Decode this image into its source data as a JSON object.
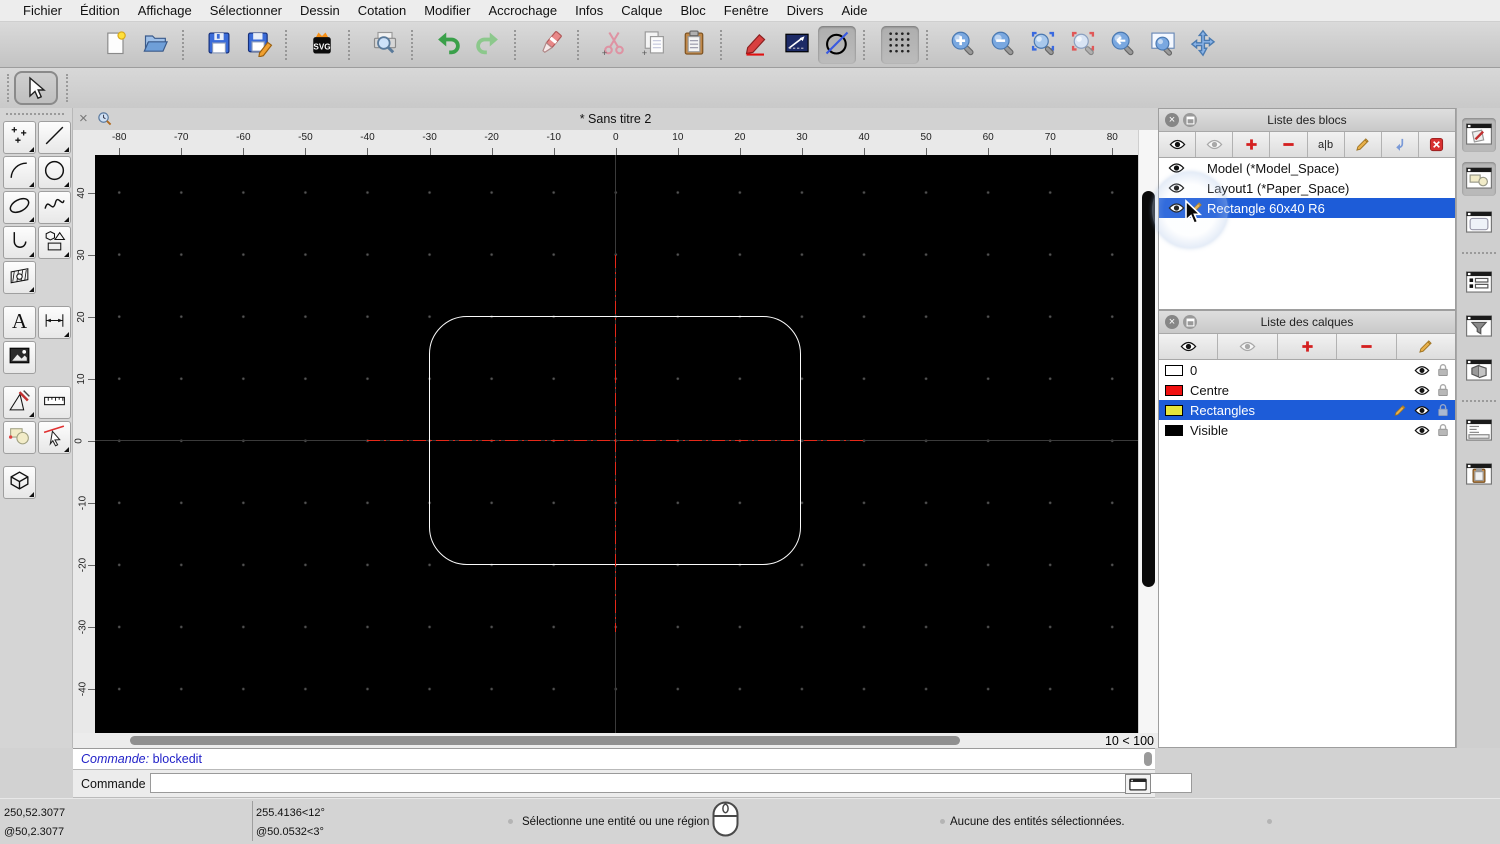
{
  "menu": {
    "items": [
      "Fichier",
      "Édition",
      "Affichage",
      "Sélectionner",
      "Dessin",
      "Cotation",
      "Modifier",
      "Accrochage",
      "Infos",
      "Calque",
      "Bloc",
      "Fenêtre",
      "Divers",
      "Aide"
    ]
  },
  "toolbar": {
    "groups": [
      [
        {
          "name": "new-document-icon"
        },
        {
          "name": "open-folder-icon"
        }
      ],
      [
        {
          "name": "save-icon"
        },
        {
          "name": "save-as-icon"
        }
      ],
      [
        {
          "name": "svg-export-icon"
        }
      ],
      [
        {
          "name": "print-preview-icon"
        }
      ],
      [
        {
          "name": "undo-icon"
        },
        {
          "name": "redo-icon"
        }
      ],
      [
        {
          "name": "delete-icon"
        }
      ],
      [
        {
          "name": "cut-icon"
        },
        {
          "name": "copy-icon"
        },
        {
          "name": "paste-icon"
        }
      ],
      [
        {
          "name": "draw-order-icon"
        },
        {
          "name": "line-angle-icon"
        },
        {
          "name": "isometric-grid-icon",
          "pressed": true
        }
      ],
      [
        {
          "name": "grid-icon",
          "pressed": true
        }
      ],
      [
        {
          "name": "zoom-in-icon"
        },
        {
          "name": "zoom-out-icon"
        },
        {
          "name": "zoom-auto-icon"
        },
        {
          "name": "zoom-previous-icon"
        },
        {
          "name": "zoom-redraw-icon"
        },
        {
          "name": "zoom-window-icon"
        },
        {
          "name": "zoom-pan-icon"
        }
      ]
    ]
  },
  "palette": {
    "groups": [
      [
        {
          "name": "point-tool",
          "submenu": true
        },
        {
          "name": "line-tool",
          "submenu": true
        },
        {
          "name": "arc-tool",
          "submenu": true
        },
        {
          "name": "circle-tool",
          "submenu": true
        },
        {
          "name": "ellipse-tool",
          "submenu": true
        },
        {
          "name": "spline-tool",
          "submenu": true
        },
        {
          "name": "polyline-tool",
          "submenu": true
        },
        {
          "name": "polygon-tool",
          "submenu": true
        },
        {
          "name": "hatch-tool",
          "submenu": true
        },
        null
      ],
      [
        {
          "name": "text-tool",
          "submenu": false
        },
        {
          "name": "dimension-tool",
          "submenu": true
        },
        {
          "name": "image-tool",
          "submenu": false
        },
        null
      ],
      [
        {
          "name": "modify-tool",
          "submenu": true
        },
        {
          "name": "measure-tool",
          "submenu": false
        },
        {
          "name": "order-tool",
          "submenu": false
        },
        {
          "name": "select-entity-tool",
          "submenu": true
        }
      ],
      [
        {
          "name": "solid-tool",
          "submenu": true
        },
        null
      ]
    ]
  },
  "document": {
    "title": "* Sans titre 2",
    "zoom_indicator": "10 < 100",
    "h_ruler": [
      "-80",
      "-70",
      "-60",
      "-50",
      "-40",
      "-30",
      "-20",
      "-10",
      "0",
      "10",
      "20",
      "30",
      "40",
      "50",
      "60",
      "70",
      "80"
    ],
    "v_ruler": [
      "40",
      "30",
      "20",
      "10",
      "0",
      "-10",
      "-20",
      "-30",
      "-40"
    ]
  },
  "blocks_panel": {
    "title": "Liste des blocs",
    "toolbar": [
      "eye-icon",
      "eye-gray-icon",
      "plus-icon",
      "minus-icon",
      "rename-icon",
      "pencil-icon",
      "insert-block-icon",
      "delete-block-icon"
    ],
    "items": [
      {
        "label": "Model (*Model_Space)",
        "selected": false,
        "editing": false
      },
      {
        "label": "Layout1 (*Paper_Space)",
        "selected": false,
        "editing": false
      },
      {
        "label": "Rectangle 60x40 R6",
        "selected": true,
        "editing": true
      }
    ]
  },
  "layers_panel": {
    "title": "Liste des calques",
    "toolbar": [
      "eye-icon",
      "eye-gray-icon",
      "plus-icon",
      "minus-icon",
      "pencil-icon"
    ],
    "items": [
      {
        "name": "0",
        "color": "#ffffff",
        "selected": false,
        "editing": false
      },
      {
        "name": "Centre",
        "color": "#f01010",
        "selected": false,
        "editing": false
      },
      {
        "name": "Rectangles",
        "color": "#e6e63c",
        "selected": true,
        "editing": true
      },
      {
        "name": "Visible",
        "color": "#000000",
        "selected": false,
        "editing": false
      }
    ]
  },
  "dock_bar": {
    "groups": [
      [
        {
          "name": "block-edit-dock-icon",
          "pressed": true
        },
        {
          "name": "library-dock-icon",
          "pressed": true
        },
        {
          "name": "frame-dock-icon",
          "pressed": false
        }
      ],
      [
        {
          "name": "layer-list-dock-icon",
          "pressed": false
        },
        {
          "name": "filter-dock-icon",
          "pressed": false
        },
        {
          "name": "material-dock-icon",
          "pressed": false
        }
      ],
      [
        {
          "name": "command-dock-icon",
          "pressed": false
        },
        {
          "name": "clipboard-dock-icon",
          "pressed": false
        }
      ]
    ]
  },
  "command": {
    "history_label": "Commande:",
    "history_value": "blockedit",
    "prompt": "Commande :",
    "input_value": ""
  },
  "status": {
    "coord_abs": "250,52.3077",
    "coord_rel": "@50,2.3077",
    "polar_abs": "255.4136<12°",
    "polar_rel": "@50.0532<3°",
    "hint": "Sélectionne une entité ou une région",
    "selection": "Aucune des entités sélectionnées."
  },
  "colors": {
    "selection": "#1d5cd8",
    "canvas": "#000000",
    "centerline": "#e62818",
    "entity": "#fafafa",
    "layer_yellow": "#e6e63c",
    "layer_red": "#f01010"
  }
}
